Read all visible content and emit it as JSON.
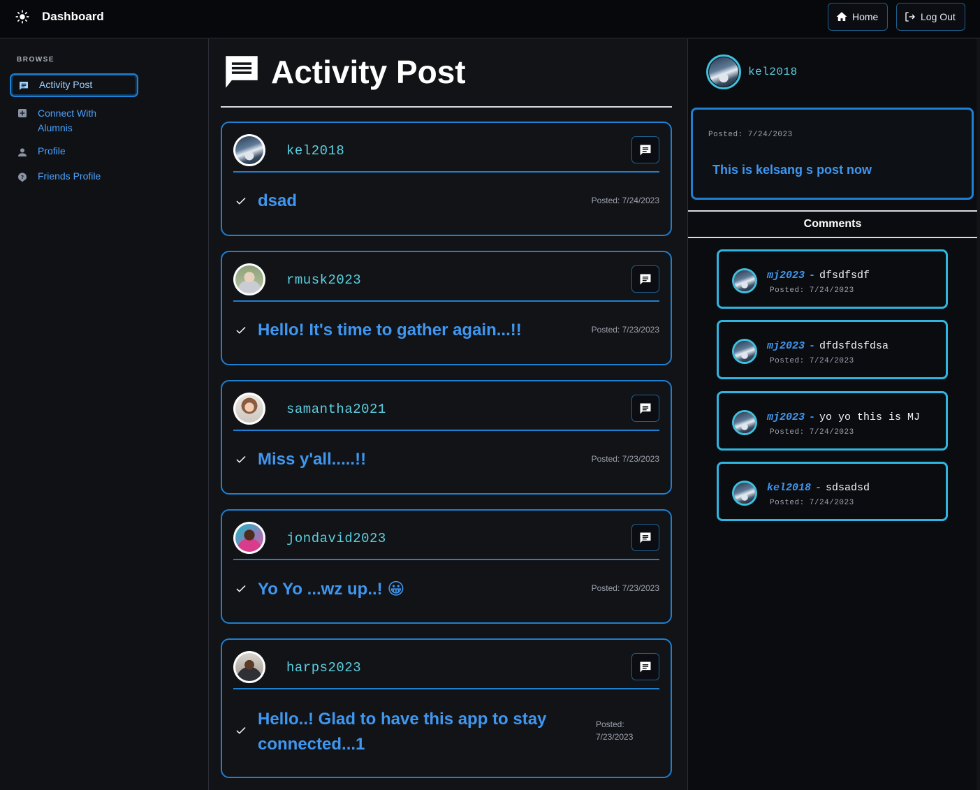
{
  "header": {
    "title": "Dashboard",
    "home_label": "Home",
    "logout_label": "Log Out"
  },
  "sidebar": {
    "section_label": "BROWSE",
    "items": [
      {
        "label": "Activity Post",
        "icon": "chat-icon",
        "active": true
      },
      {
        "label": "Connect With Alumnis",
        "icon": "grid-icon",
        "active": false
      },
      {
        "label": "Profile",
        "icon": "person-icon",
        "active": false
      },
      {
        "label": "Friends Profile",
        "icon": "help-icon",
        "active": false
      }
    ]
  },
  "main": {
    "title": "Activity Post",
    "posts": [
      {
        "user": "kel2018",
        "text": "dsad",
        "date": "Posted: 7/24/2023"
      },
      {
        "user": "rmusk2023",
        "text": "Hello! It's time to gather again...!!",
        "date": "Posted: 7/23/2023"
      },
      {
        "user": "samantha2021",
        "text": "Miss y'all.....!!",
        "date": "Posted: 7/23/2023"
      },
      {
        "user": "jondavid2023",
        "text": "Yo Yo ...wz up..! 😀",
        "date": "Posted: 7/23/2023"
      },
      {
        "user": "harps2023",
        "text": "Hello..! Glad to have this app to stay connected...1",
        "date_line1": "Posted:",
        "date_line2": "7/23/2023"
      }
    ]
  },
  "detail": {
    "user": "kel2018",
    "post_date": "Posted: 7/24/2023",
    "post_text": "This is kelsang s post now",
    "comments_heading": "Comments",
    "separator": "-",
    "comments": [
      {
        "user": "mj2023",
        "text": "dfsdfsdf",
        "date": "Posted: 7/24/2023"
      },
      {
        "user": "mj2023",
        "text": "dfdsfdsfdsa",
        "date": "Posted: 7/24/2023"
      },
      {
        "user": "mj2023",
        "text": "yo yo this is MJ",
        "date": "Posted: 7/24/2023"
      },
      {
        "user": "kel2018",
        "text": "sdsadsd",
        "date": "Posted: 7/24/2023"
      }
    ]
  },
  "colors": {
    "accent": "#1f7fd0",
    "link": "#3f97f0",
    "username": "#5ad0e0",
    "background": "#121317"
  }
}
